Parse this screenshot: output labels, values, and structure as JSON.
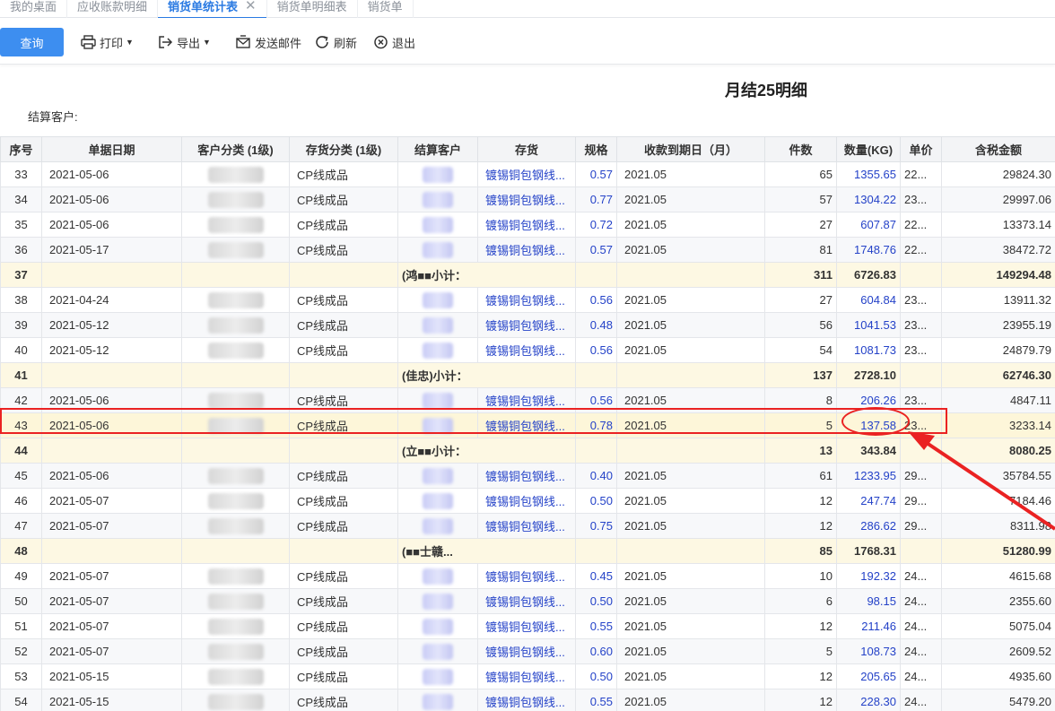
{
  "tabs": [
    {
      "label": "我的桌面",
      "active": false
    },
    {
      "label": "应收账款明细",
      "active": false
    },
    {
      "label": "销货单统计表",
      "active": true
    },
    {
      "label": "销货单明细表",
      "active": false
    },
    {
      "label": "销货单",
      "active": false
    }
  ],
  "tab_close_glyph": "✕",
  "toolbar": {
    "query": "查询",
    "print": "打印",
    "export": "导出",
    "email": "发送邮件",
    "refresh": "刷新",
    "exit": "退出"
  },
  "report": {
    "title": "月结25明细",
    "customer_label": "结算客户:"
  },
  "table": {
    "columns": [
      "序号",
      "单据日期",
      "客户分类 (1级)",
      "存货分类 (1级)",
      "结算客户",
      "存货",
      "规格",
      "收款到期日（月）",
      "件数",
      "数量(KG)",
      "单价",
      "含税金额"
    ],
    "rows": [
      {
        "type": "data",
        "no": "33",
        "date": "2021-05-06",
        "cust_cat": "",
        "stock_cat": "CP线成品",
        "customer": "",
        "item": "镀锡铜包钢线...",
        "spec": "0.57",
        "due": "2021.05",
        "pieces": "65",
        "qty": "1355.65",
        "price": "22...",
        "amount": "29824.30"
      },
      {
        "type": "data",
        "no": "34",
        "date": "2021-05-06",
        "cust_cat": "",
        "stock_cat": "CP线成品",
        "customer": "",
        "item": "镀锡铜包钢线...",
        "spec": "0.77",
        "due": "2021.05",
        "pieces": "57",
        "qty": "1304.22",
        "price": "23...",
        "amount": "29997.06"
      },
      {
        "type": "data",
        "no": "35",
        "date": "2021-05-06",
        "cust_cat": "",
        "stock_cat": "CP线成品",
        "customer": "",
        "item": "镀锡铜包钢线...",
        "spec": "0.72",
        "due": "2021.05",
        "pieces": "27",
        "qty": "607.87",
        "price": "22...",
        "amount": "13373.14"
      },
      {
        "type": "data",
        "no": "36",
        "date": "2021-05-17",
        "cust_cat": "",
        "stock_cat": "CP线成品",
        "customer": "",
        "item": "镀锡铜包钢线...",
        "spec": "0.57",
        "due": "2021.05",
        "pieces": "81",
        "qty": "1748.76",
        "price": "22...",
        "amount": "38472.72"
      },
      {
        "type": "subtotal",
        "no": "37",
        "label": "(鸿■■小计：",
        "pieces": "311",
        "qty": "6726.83",
        "amount": "149294.48"
      },
      {
        "type": "data",
        "no": "38",
        "date": "2021-04-24",
        "cust_cat": "",
        "stock_cat": "CP线成品",
        "customer": "",
        "item": "镀锡铜包钢线...",
        "spec": "0.56",
        "due": "2021.05",
        "pieces": "27",
        "qty": "604.84",
        "price": "23...",
        "amount": "13911.32"
      },
      {
        "type": "data",
        "no": "39",
        "date": "2021-05-12",
        "cust_cat": "",
        "stock_cat": "CP线成品",
        "customer": "",
        "item": "镀锡铜包钢线...",
        "spec": "0.48",
        "due": "2021.05",
        "pieces": "56",
        "qty": "1041.53",
        "price": "23...",
        "amount": "23955.19"
      },
      {
        "type": "data",
        "no": "40",
        "date": "2021-05-12",
        "cust_cat": "",
        "stock_cat": "CP线成品",
        "customer": "",
        "item": "镀锡铜包钢线...",
        "spec": "0.56",
        "due": "2021.05",
        "pieces": "54",
        "qty": "1081.73",
        "price": "23...",
        "amount": "24879.79"
      },
      {
        "type": "subtotal",
        "no": "41",
        "label": "(佳忠)小计：",
        "pieces": "137",
        "qty": "2728.10",
        "amount": "62746.30"
      },
      {
        "type": "data",
        "no": "42",
        "date": "2021-05-06",
        "cust_cat": "",
        "stock_cat": "CP线成品",
        "customer": "",
        "item": "镀锡铜包钢线...",
        "spec": "0.56",
        "due": "2021.05",
        "pieces": "8",
        "qty": "206.26",
        "price": "23...",
        "amount": "4847.11"
      },
      {
        "type": "data",
        "no": "43",
        "date": "2021-05-06",
        "cust_cat": "",
        "stock_cat": "CP线成品",
        "customer": "",
        "item": "镀锡铜包钢线...",
        "spec": "0.78",
        "due": "2021.05",
        "pieces": "5",
        "qty": "137.58",
        "price": "23...",
        "amount": "3233.14",
        "highlight": true
      },
      {
        "type": "subtotal",
        "no": "44",
        "label": "(立■■小计：",
        "pieces": "13",
        "qty": "343.84",
        "amount": "8080.25"
      },
      {
        "type": "data",
        "no": "45",
        "date": "2021-05-06",
        "cust_cat": "",
        "stock_cat": "CP线成品",
        "customer": "",
        "item": "镀锡铜包钢线...",
        "spec": "0.40",
        "due": "2021.05",
        "pieces": "61",
        "qty": "1233.95",
        "price": "29...",
        "amount": "35784.55"
      },
      {
        "type": "data",
        "no": "46",
        "date": "2021-05-07",
        "cust_cat": "",
        "stock_cat": "CP线成品",
        "customer": "",
        "item": "镀锡铜包钢线...",
        "spec": "0.50",
        "due": "2021.05",
        "pieces": "12",
        "qty": "247.74",
        "price": "29...",
        "amount": "7184.46"
      },
      {
        "type": "data",
        "no": "47",
        "date": "2021-05-07",
        "cust_cat": "",
        "stock_cat": "CP线成品",
        "customer": "",
        "item": "镀锡铜包钢线...",
        "spec": "0.75",
        "due": "2021.05",
        "pieces": "12",
        "qty": "286.62",
        "price": "29...",
        "amount": "8311.98"
      },
      {
        "type": "subtotal",
        "no": "48",
        "label": "(■■士赣...",
        "pieces": "85",
        "qty": "1768.31",
        "amount": "51280.99"
      },
      {
        "type": "data",
        "no": "49",
        "date": "2021-05-07",
        "cust_cat": "",
        "stock_cat": "CP线成品",
        "customer": "",
        "item": "镀锡铜包钢线...",
        "spec": "0.45",
        "due": "2021.05",
        "pieces": "10",
        "qty": "192.32",
        "price": "24...",
        "amount": "4615.68"
      },
      {
        "type": "data",
        "no": "50",
        "date": "2021-05-07",
        "cust_cat": "",
        "stock_cat": "CP线成品",
        "customer": "",
        "item": "镀锡铜包钢线...",
        "spec": "0.50",
        "due": "2021.05",
        "pieces": "6",
        "qty": "98.15",
        "price": "24...",
        "amount": "2355.60"
      },
      {
        "type": "data",
        "no": "51",
        "date": "2021-05-07",
        "cust_cat": "",
        "stock_cat": "CP线成品",
        "customer": "",
        "item": "镀锡铜包钢线...",
        "spec": "0.55",
        "due": "2021.05",
        "pieces": "12",
        "qty": "211.46",
        "price": "24...",
        "amount": "5075.04"
      },
      {
        "type": "data",
        "no": "52",
        "date": "2021-05-07",
        "cust_cat": "",
        "stock_cat": "CP线成品",
        "customer": "",
        "item": "镀锡铜包钢线...",
        "spec": "0.60",
        "due": "2021.05",
        "pieces": "5",
        "qty": "108.73",
        "price": "24...",
        "amount": "2609.52"
      },
      {
        "type": "data",
        "no": "53",
        "date": "2021-05-15",
        "cust_cat": "",
        "stock_cat": "CP线成品",
        "customer": "",
        "item": "镀锡铜包钢线...",
        "spec": "0.50",
        "due": "2021.05",
        "pieces": "12",
        "qty": "205.65",
        "price": "24...",
        "amount": "4935.60"
      },
      {
        "type": "data",
        "no": "54",
        "date": "2021-05-15",
        "cust_cat": "",
        "stock_cat": "CP线成品",
        "customer": "",
        "item": "镀锡铜包钢线...",
        "spec": "0.55",
        "due": "2021.05",
        "pieces": "12",
        "qty": "228.30",
        "price": "24...",
        "amount": "5479.20"
      }
    ]
  },
  "colors": {
    "accent": "#2a7ae2",
    "query_button": "#3d8ef0",
    "link": "#2442c8",
    "subtotal_row": "#fdf8e3",
    "annotation": "#ea2222"
  },
  "icons": {
    "print": "printer-icon",
    "export": "export-icon",
    "email": "email-icon",
    "refresh": "refresh-icon",
    "exit": "exit-icon"
  }
}
